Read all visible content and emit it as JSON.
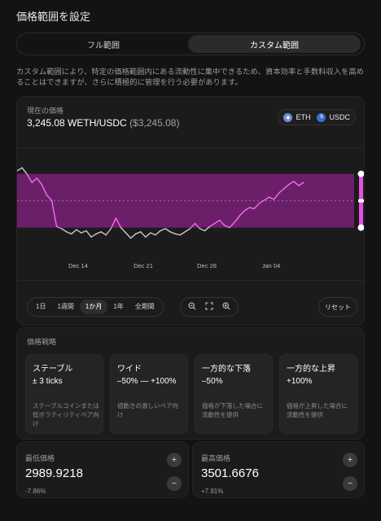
{
  "header": {
    "title": "価格範囲を設定"
  },
  "mode_toggle": {
    "full_label": "フル範囲",
    "custom_label": "カスタム範囲",
    "selected": "カスタム範囲"
  },
  "description": "カスタム範囲により、特定の価格範囲内にある流動性に集中できるため、資本効率と手数料収入を高めることはできますが、さらに積極的に管理を行う必要があります。",
  "current_price": {
    "label": "現在の価格",
    "value": "3,245.08 WETH/USDC",
    "usd": "($3,245.08)"
  },
  "tokens": [
    {
      "symbol": "ETH",
      "icon": "eth-icon"
    },
    {
      "symbol": "USDC",
      "icon": "usdc-icon"
    }
  ],
  "chart_data": {
    "type": "line",
    "x_ticks": [
      "Dec 14",
      "Dec 21",
      "Dec 28",
      "Jan 04"
    ],
    "ylim": [
      2700,
      3700
    ],
    "series": [
      {
        "values": [
          3530,
          3560,
          3500,
          3420,
          3460,
          3400,
          3300,
          3250,
          3000,
          2980,
          2950,
          2930,
          2970,
          2940,
          2960,
          2900,
          2930,
          2950,
          2920,
          2980,
          3080,
          2990,
          2940,
          2890,
          2930,
          2950,
          2900,
          2940,
          2920,
          2960,
          2980,
          2950,
          2930,
          2920,
          2950,
          2980,
          3030,
          2980,
          2960,
          3000,
          3030,
          3060,
          3010,
          2990,
          3040,
          3100,
          3150,
          3180,
          3170,
          3220,
          3250,
          3280,
          3260,
          3320,
          3360,
          3400,
          3430,
          3390,
          3420
        ]
      }
    ],
    "range": {
      "min": 2989.9218,
      "max": 3501.6676
    },
    "current": 3245.08
  },
  "colors": {
    "accent": "#e94de8",
    "range_fill": "#6b1f69",
    "line_in": "#f36ef1",
    "line_out": "#c9c9c9"
  },
  "timeframes": {
    "items": [
      "1日",
      "1週間",
      "1か月",
      "1年",
      "全期間"
    ],
    "active": "1か月"
  },
  "zoom": {
    "icons": [
      "zoom-out-icon",
      "fit-icon",
      "zoom-in-icon"
    ]
  },
  "reset_label": "リセット",
  "strategy": {
    "title": "価格戦略",
    "cards": [
      {
        "title": "ステーブル",
        "value": "± 3 ticks",
        "desc": "ステーブルコインまたは低ボラティリティペア向け"
      },
      {
        "title": "ワイド",
        "value": "–50% — +100%",
        "desc": "値動きの激しいペア向け"
      },
      {
        "title": "一方的な下落",
        "value": "–50%",
        "desc": "価格が下落した場合に流動性を提供"
      },
      {
        "title": "一方的な上昇",
        "value": "+100%",
        "desc": "価格が上昇した場合に流動性を提供"
      }
    ]
  },
  "min_price": {
    "label": "最低価格",
    "value": "2989.9218",
    "pct": "-7.86%"
  },
  "max_price": {
    "label": "最高価格",
    "value": "3501.6676",
    "pct": "+7.91%"
  }
}
